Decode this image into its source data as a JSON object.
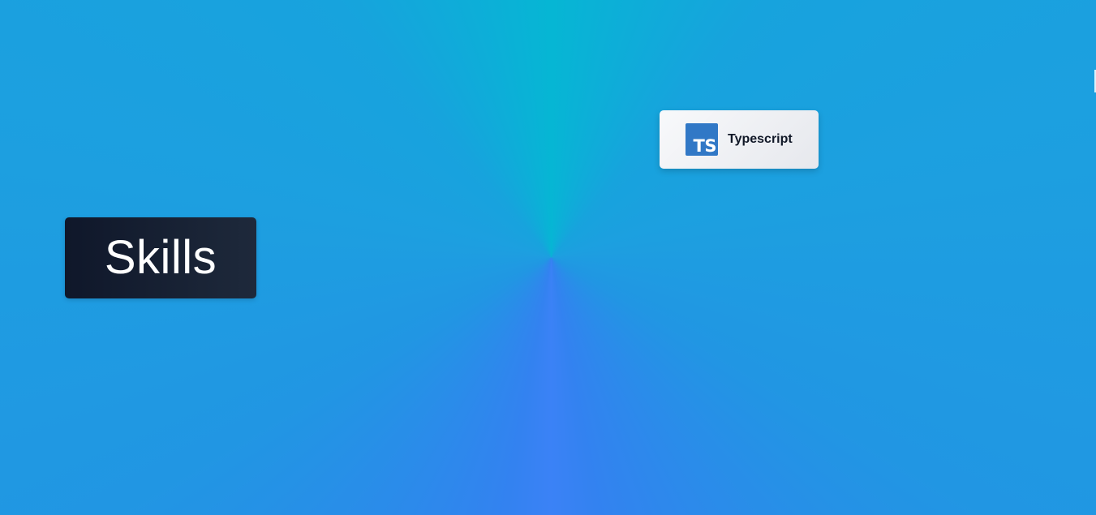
{
  "section": {
    "title": "Skills"
  },
  "skills": [
    {
      "label": "Typescript",
      "logo_text": "TS",
      "icon": "typescript-icon",
      "logo_color": "#3178c6"
    }
  ],
  "colors": {
    "background_primary": "#1d9fe0",
    "background_cyan": "#06b6d4",
    "background_blue": "#3b82f6",
    "badge_dark": "#0f172a",
    "card_light": "#f3f4f6",
    "text_dark": "#111827"
  }
}
